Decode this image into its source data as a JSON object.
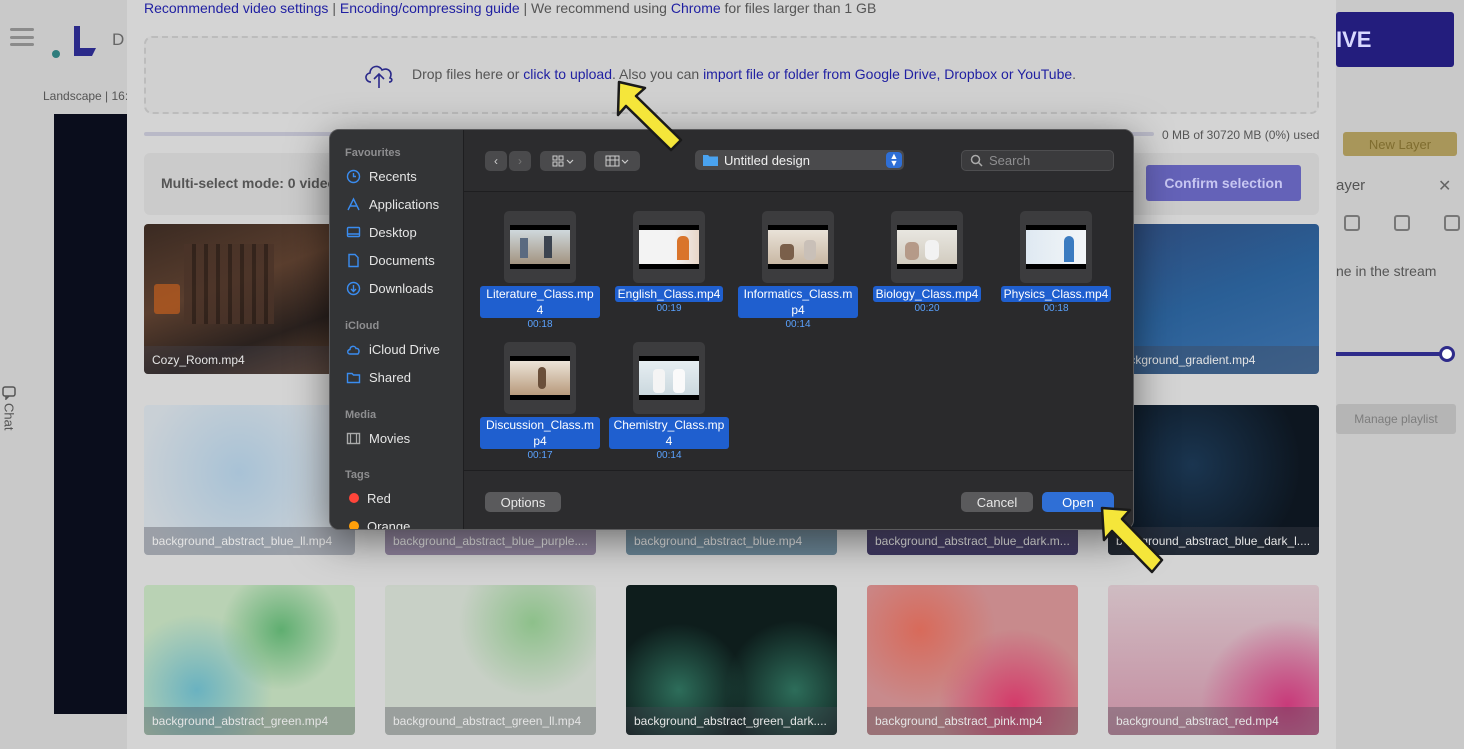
{
  "background": {
    "logo_text": "D",
    "landscape_label": "Landscape | 16:",
    "chat_label": "Chat",
    "live_label": "IVE",
    "new_layer_label": "New Layer",
    "layer_label": "ayer",
    "stream_text": "ne in the stream",
    "manage_playlist_label": "Manage playlist"
  },
  "upload": {
    "links": {
      "recommended": "Recommended video settings",
      "sep1": " | ",
      "guide": "Encoding/compressing guide",
      "sep2": " | We recommend using ",
      "chrome": "Chrome",
      "suffix": " for files larger than 1 GB"
    },
    "drop": {
      "prefix": "Drop files here or ",
      "click": "click to upload",
      "middle": ". Also you can ",
      "import": "import file or folder from Google Drive, Dropbox or YouTube",
      "end": "."
    },
    "usage_text": "0 MB of 30720 MB (0%) used",
    "usage_fraction": 0,
    "multi_select_label": "Multi-select mode: 0 video",
    "confirm_label": "Confirm selection"
  },
  "library": [
    {
      "name": "Cozy_Room.mp4"
    },
    {
      "name": "background_gradient.mp4"
    },
    {
      "name": "background_abstract_blue_ll.mp4"
    },
    {
      "name": "background_abstract_blue_purple...."
    },
    {
      "name": "background_abstract_blue.mp4"
    },
    {
      "name": "background_abstract_blue_dark.m..."
    },
    {
      "name": "background_abstract_blue_dark_l...."
    },
    {
      "name": "background_abstract_green.mp4"
    },
    {
      "name": "background_abstract_green_ll.mp4"
    },
    {
      "name": "background_abstract_green_dark...."
    },
    {
      "name": "background_abstract_pink.mp4"
    },
    {
      "name": "background_abstract_red.mp4"
    }
  ],
  "dialog": {
    "sidebar": {
      "favourites_title": "Favourites",
      "favourites": [
        {
          "label": "Recents",
          "icon": "clock-icon"
        },
        {
          "label": "Applications",
          "icon": "applications-icon"
        },
        {
          "label": "Desktop",
          "icon": "desktop-icon"
        },
        {
          "label": "Documents",
          "icon": "document-icon"
        },
        {
          "label": "Downloads",
          "icon": "download-icon"
        }
      ],
      "icloud_title": "iCloud",
      "icloud": [
        {
          "label": "iCloud Drive",
          "icon": "cloud-icon"
        },
        {
          "label": "Shared",
          "icon": "shared-folder-icon"
        }
      ],
      "media_title": "Media",
      "media": [
        {
          "label": "Movies",
          "icon": "film-icon"
        }
      ],
      "tags_title": "Tags",
      "tags": [
        {
          "label": "Red",
          "color": "#ff453a"
        },
        {
          "label": "Orange",
          "color": "#ff9f0a"
        }
      ]
    },
    "toolbar": {
      "current_folder": "Untitled design",
      "search_placeholder": "Search"
    },
    "files": [
      {
        "name": "Literature_Class.mp4",
        "duration": "00:18"
      },
      {
        "name": "English_Class.mp4",
        "duration": "00:19"
      },
      {
        "name": "Informatics_Class.mp4",
        "duration": "00:14"
      },
      {
        "name": "Biology_Class.mp4",
        "duration": "00:20"
      },
      {
        "name": "Physics_Class.mp4",
        "duration": "00:18"
      },
      {
        "name": "Discussion_Class.mp4",
        "duration": "00:17"
      },
      {
        "name": "Chemistry_Class.mp4",
        "duration": "00:14"
      }
    ],
    "footer": {
      "options_label": "Options",
      "cancel_label": "Cancel",
      "open_label": "Open"
    }
  },
  "colors": {
    "accent_blue": "#2f6fd6",
    "selection_blue": "#1f5fcf",
    "link_blue": "#1f1fa2",
    "annotation_yellow": "#f5e63a"
  }
}
